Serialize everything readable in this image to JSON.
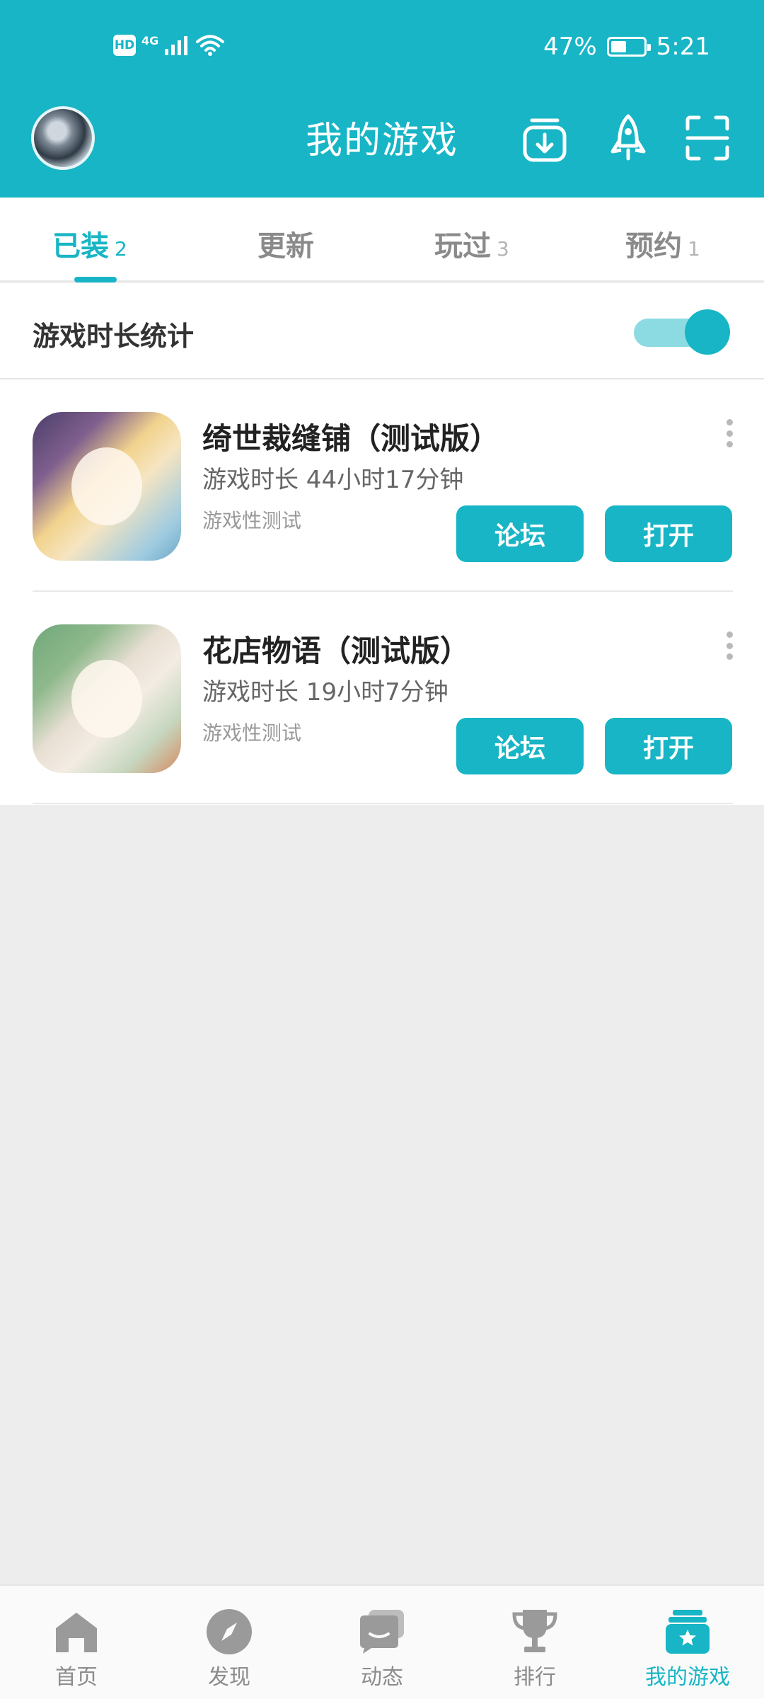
{
  "status_bar": {
    "network": "4G",
    "battery_percent": "47%",
    "battery_level": 0.47,
    "time": "5:21",
    "hd_label": "HD"
  },
  "header": {
    "title": "我的游戏",
    "icons": [
      "download-manager-icon",
      "rocket-icon",
      "scan-icon"
    ]
  },
  "tabs": [
    {
      "label": "已装",
      "count": "2",
      "active": true
    },
    {
      "label": "更新",
      "count": "",
      "active": false
    },
    {
      "label": "玩过",
      "count": "3",
      "active": false
    },
    {
      "label": "预约",
      "count": "1",
      "active": false
    }
  ],
  "stats": {
    "label": "游戏时长统计",
    "toggle_on": true
  },
  "games": [
    {
      "name": "绮世裁缝铺（测试版）",
      "playtime": "游戏时长 44小时17分钟",
      "tag": "游戏性测试",
      "forum_label": "论坛",
      "open_label": "打开"
    },
    {
      "name": "花店物语（测试版）",
      "playtime": "游戏时长 19小时7分钟",
      "tag": "游戏性测试",
      "forum_label": "论坛",
      "open_label": "打开"
    }
  ],
  "bottom_nav": [
    {
      "label": "首页",
      "icon": "home-icon",
      "active": false
    },
    {
      "label": "发现",
      "icon": "compass-icon",
      "active": false
    },
    {
      "label": "动态",
      "icon": "chat-bubbles-icon",
      "active": false
    },
    {
      "label": "排行",
      "icon": "trophy-icon",
      "active": false
    },
    {
      "label": "我的游戏",
      "icon": "game-library-icon",
      "active": true
    }
  ],
  "colors": {
    "accent": "#17b5c5",
    "toggle_track": "#8cdbe3",
    "background": "#ededed",
    "inactive_nav": "#8c8c8c"
  }
}
